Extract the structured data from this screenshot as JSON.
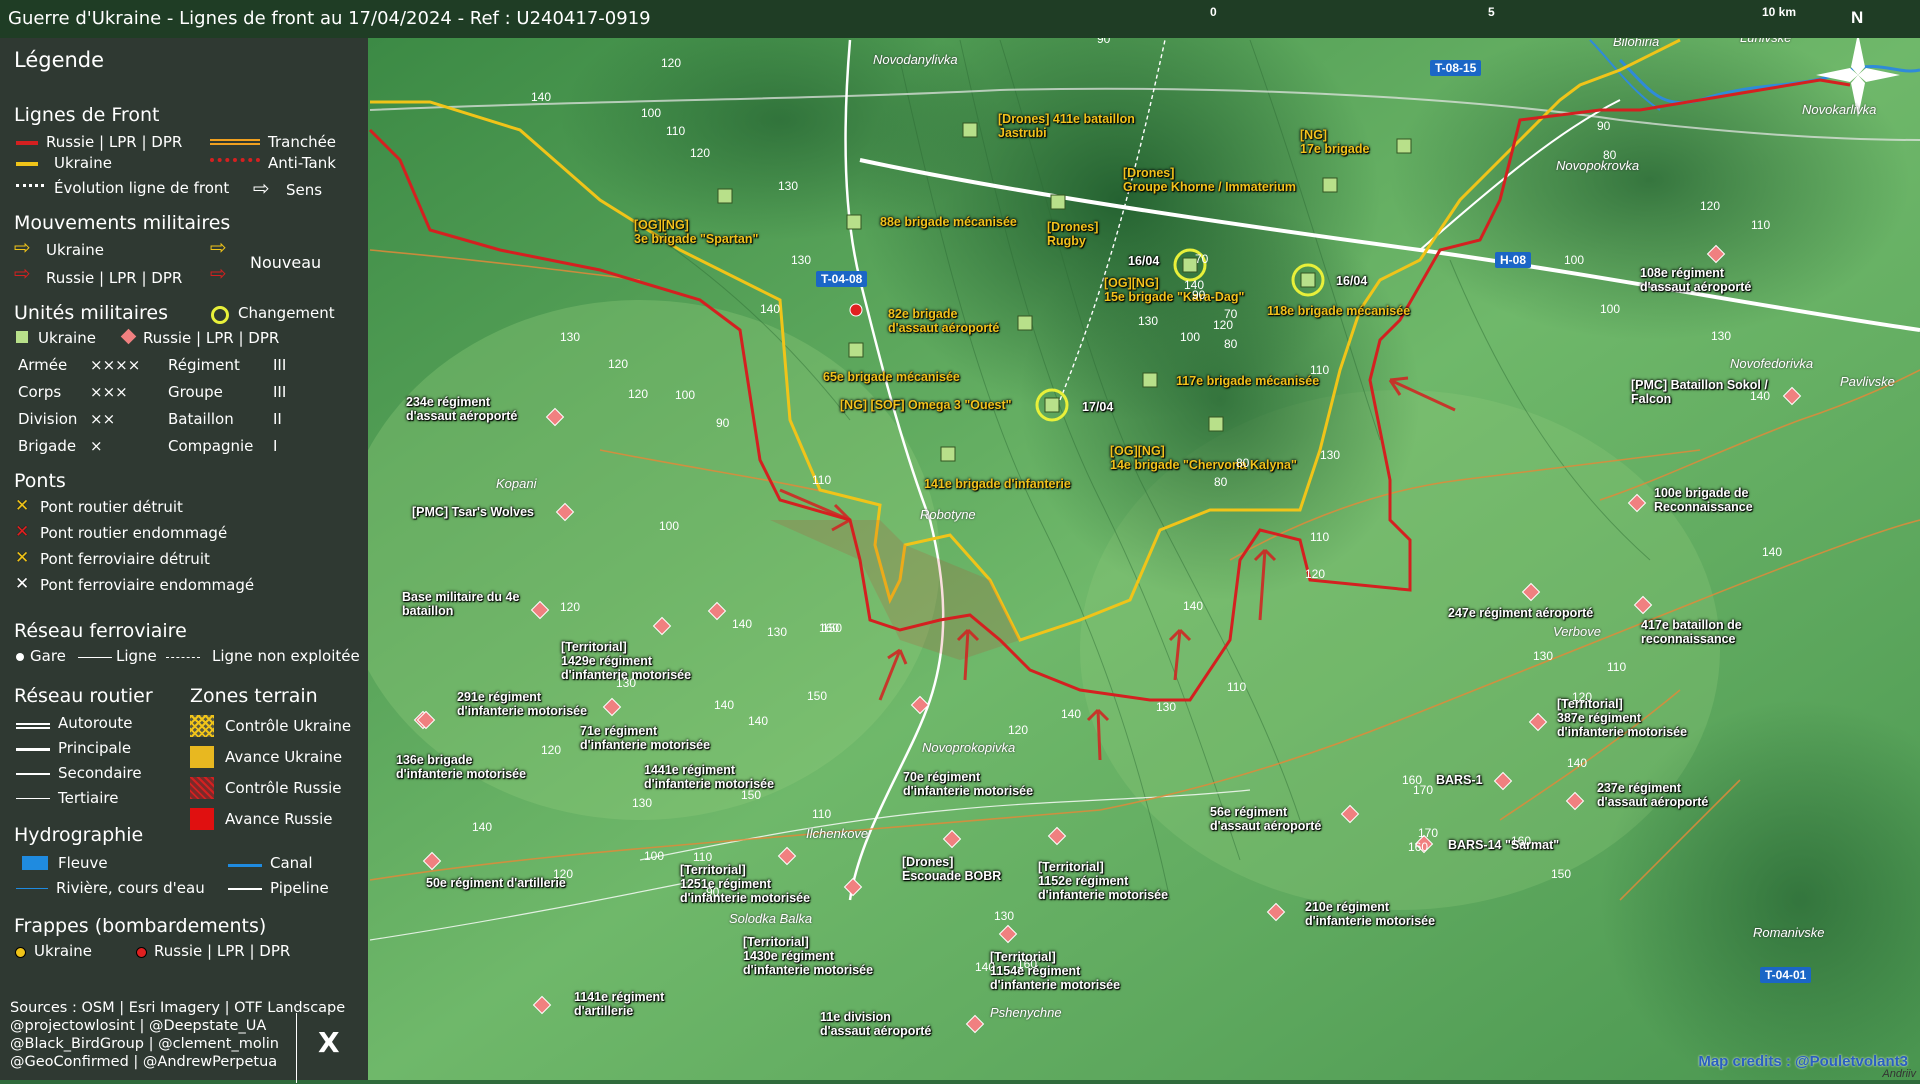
{
  "title": "Guerre d'Ukraine - Lignes de front au 17/04/2024 - Ref : U240417-0919",
  "scale": {
    "label_0": "0",
    "label_5": "5",
    "label_10": "10 km"
  },
  "north": "N",
  "colors": {
    "russia": "#d42020",
    "ukraine": "#f0c419",
    "unit_ua": "#b8e08a",
    "unit_ru": "#f08080",
    "change": "#e8f03a"
  },
  "legend": {
    "title": "Légende",
    "front": {
      "heading": "Lignes de Front",
      "russia": "Russie | LPR | DPR",
      "ukraine": "Ukraine",
      "trench": "Tranchée",
      "antitank": "Anti-Tank",
      "evolution": "Évolution ligne de front",
      "direction": "Sens"
    },
    "movements": {
      "heading": "Mouvements militaires",
      "ukraine": "Ukraine",
      "russia": "Russie | LPR | DPR",
      "new": "Nouveau"
    },
    "units": {
      "heading": "Unités militaires",
      "change": "Changement",
      "ukraine": "Ukraine",
      "russia": "Russie | LPR | DPR",
      "ranks": [
        [
          "Armée",
          "××××",
          "Régiment",
          "III"
        ],
        [
          "Corps",
          "×××",
          "Groupe",
          "III"
        ],
        [
          "Division",
          "××",
          "Bataillon",
          "II"
        ],
        [
          "Brigade",
          "×",
          "Compagnie",
          "I"
        ]
      ]
    },
    "bridges": {
      "heading": "Ponts",
      "items": [
        "Pont routier détruit",
        "Pont routier endommagé",
        "Pont ferroviaire détruit",
        "Pont ferroviaire endommagé"
      ]
    },
    "rail": {
      "heading": "Réseau ferroviaire",
      "station": "Gare",
      "line": "Ligne",
      "unused": "Ligne non exploitée"
    },
    "roads": {
      "heading": "Réseau routier",
      "items": [
        "Autoroute",
        "Principale",
        "Secondaire",
        "Tertiaire"
      ]
    },
    "zones": {
      "heading": "Zones terrain",
      "items": [
        "Contrôle Ukraine",
        "Avance Ukraine",
        "Contrôle Russie",
        "Avance Russie"
      ]
    },
    "hydro": {
      "heading": "Hydrographie",
      "river": "Fleuve",
      "stream": "Rivière, cours d'eau",
      "canal": "Canal",
      "pipeline": "Pipeline"
    },
    "strikes": {
      "heading": "Frappes (bombardements)",
      "ukraine": "Ukraine",
      "russia": "Russie | LPR | DPR"
    },
    "sources": [
      "Sources : OSM | Esri Imagery | OTF Landscape",
      "@projectowlosint | @Deepstate_UA",
      "@Black_BirdGroup | @clement_molin",
      "@GeoConfirmed | @AndrewPerpetua"
    ],
    "x_logo": "X"
  },
  "roads": [
    "T-04-08",
    "T-08-15",
    "H-08",
    "T-04-01"
  ],
  "places": [
    "Novodanylivka",
    "Bilohiria",
    "Luhivske",
    "Novokarlivka",
    "Novopokrovka",
    "Robotyne",
    "Kopani",
    "Novoprokopivka",
    "Ilchenkove",
    "Solodka Balka",
    "Pshenychne",
    "Verbove",
    "Novofedorivka",
    "Pavlivske",
    "Romanivske"
  ],
  "units_ua": [
    "[Drones] 411e bataillon\nJastrubi",
    "[NG]\n17e brigade",
    "[Drones]\nGroupe Khorne / Immaterium",
    "[OG][NG]\n3e brigade \"Spartan\"",
    "88e brigade mécanisée",
    "[Drones]\nRugby",
    "[OG][NG]\n15e brigade \"Kara-Dag\"",
    "118e brigade mécanisée",
    "82e brigade\nd'assaut aéroporté",
    "65e brigade mécanisée",
    "[NG] [SOF] Omega 3 \"Ouest\"",
    "117e brigade mécanisée",
    "[OG][NG]\n14e brigade \"Chervona Kalyna\"",
    "141e brigade d'infanterie"
  ],
  "dates": [
    "16/04",
    "16/04",
    "17/04"
  ],
  "units_ru": [
    "108e régiment\nd'assaut aéroporté",
    "234e régiment\nd'assaut aéroporté",
    "[PMC] Bataillon Sokol /\nFalcon",
    "[PMC] Tsar's Wolves",
    "100e brigade de\nReconnaissance",
    "Base militaire du 4e\nbataillon",
    "247e régiment aéroporté",
    "417e bataillon de\nreconnaissance",
    "[Territorial]\n1429e régiment\nd'infanterie motorisée",
    "291e régiment\nd'infanterie motorisée",
    "71e régiment\nd'infanterie motorisée",
    "[Territorial]\n387e régiment\nd'infanterie motorisée",
    "136e brigade\nd'infanterie motorisée",
    "1441e régiment\nd'infanterie motorisée",
    "70e régiment\nd'infanterie motorisée",
    "BARS-1",
    "237e régiment\nd'assaut aéroporté",
    "56e régiment\nd'assaut aéroporté",
    "BARS-14 \"Sarmat\"",
    "50e régiment d'artillerie",
    "[Territorial]\n1251e régiment\nd'infanterie motorisée",
    "[Drones]\nEscouade BOBR",
    "[Territorial]\n1152e régiment\nd'infanterie motorisée",
    "210e régiment\nd'infanterie motorisée",
    "[Territorial]\n1430e régiment\nd'infanterie motorisée",
    "[Territorial]\n1154e régiment\nd'infanterie motorisée",
    "1141e régiment\nd'artillerie",
    "11e division\nd'assaut aéroporté"
  ],
  "elevations": [
    "100",
    "90",
    "110",
    "120",
    "140",
    "100",
    "110",
    "120",
    "130",
    "130",
    "140",
    "130",
    "120",
    "120",
    "100",
    "90",
    "110",
    "100",
    "120",
    "130",
    "140",
    "130",
    "140",
    "150",
    "160",
    "150",
    "140",
    "150",
    "110",
    "120",
    "130",
    "140",
    "100",
    "110",
    "120",
    "90",
    "130",
    "140",
    "160",
    "120",
    "140",
    "130",
    "140",
    "110",
    "80",
    "80",
    "70",
    "90",
    "70",
    "80",
    "100",
    "130",
    "140",
    "120",
    "110",
    "130",
    "110",
    "120",
    "160",
    "170",
    "160",
    "170",
    "160",
    "150",
    "140",
    "130",
    "120",
    "110",
    "100",
    "100",
    "80",
    "90",
    "120",
    "110",
    "130",
    "140",
    "140"
  ],
  "credits": {
    "main": "Map credits : @Pouletvolant3",
    "sub": "Andriiv"
  }
}
